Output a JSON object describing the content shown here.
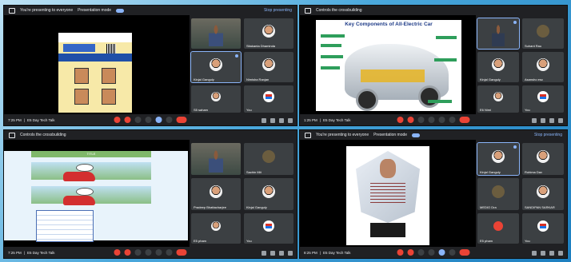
{
  "panels": [
    {
      "topbar": {
        "present_text": "You're presenting to everyone",
        "pres_label": "Presentation mode",
        "right": "Stop presenting"
      },
      "bottom": {
        "time": "7:25 PM",
        "meeting": "E5 Day Tech Talk"
      },
      "tiles": [
        "",
        "Sitakanta Dhaminda",
        "Kinjal Ganguly",
        "Nimisha Ranjan",
        "S5 saham",
        "You"
      ]
    },
    {
      "topbar": {
        "present_text": "Controls the crossbuilding"
      },
      "slide_title": "Key Components of All-Electric Car",
      "bottom": {
        "time": "1:25 PM",
        "meeting": "E5 Day Tech Talk"
      },
      "tiles": [
        "",
        "Suhant Rau",
        "Kinjal Ganguly",
        "Asansho esc",
        "E6 Nimi",
        "You"
      ]
    },
    {
      "topbar": {
        "present_text": "Controls the crossbuilding"
      },
      "slide_title": "TITLE",
      "bottom": {
        "time": "7:25 PM",
        "meeting": "E5 Day Tech Talk"
      },
      "tiles": [
        "",
        "Sachin Mit",
        "Pradeep Bhattacharjee",
        "Kinjal Ganguly",
        "E5 pham",
        "You"
      ]
    },
    {
      "topbar": {
        "present_text": "You're presenting to everyone",
        "pres_label": "Presentation mode",
        "right": "Stop presenting"
      },
      "bottom": {
        "time": "8:25 PM",
        "meeting": "E5 Day Tech Talk"
      },
      "tiles": [
        "Kinjal Ganguly",
        "Rohima Dav",
        "MEDIO Dra",
        "SANDIPAN SARKAR",
        "E5 pham",
        "You"
      ]
    }
  ],
  "icons": [
    "mic-icon",
    "camera-icon",
    "captions-icon",
    "hand-icon",
    "present-icon",
    "more-icon",
    "end-call-icon",
    "info-icon",
    "people-icon",
    "chat-icon",
    "activities-icon"
  ],
  "colors": {
    "accent": "#8ab4f8",
    "end": "#ea4335",
    "bg": "#202124"
  }
}
